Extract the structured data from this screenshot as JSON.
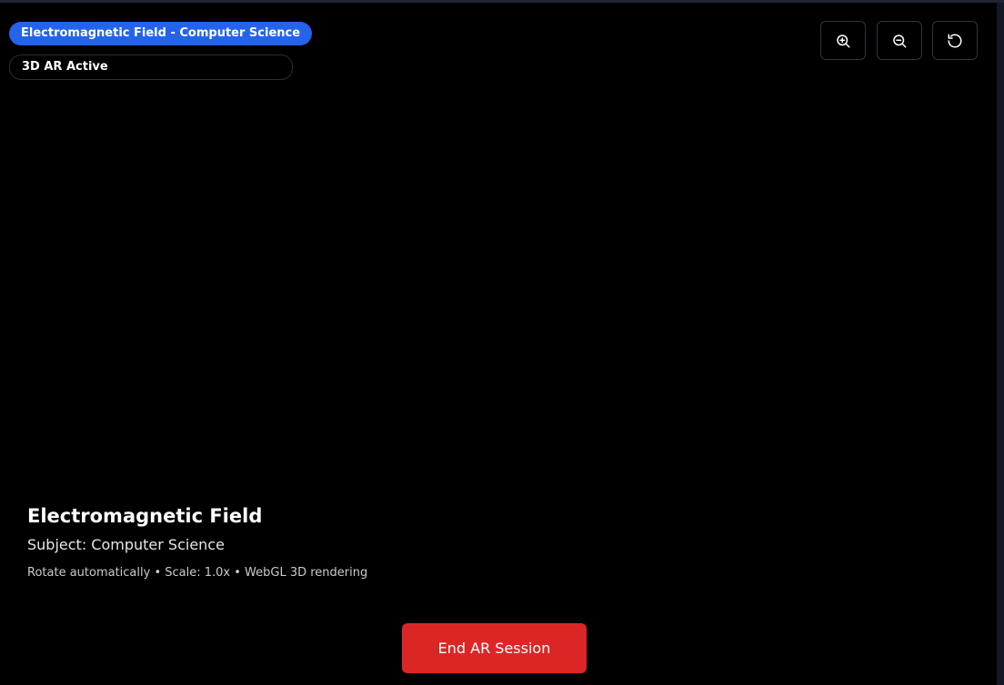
{
  "badges": {
    "primary": "Electromagnetic Field - Computer Science",
    "secondary": "3D AR Active"
  },
  "toolbar": {
    "zoom_in_icon": "zoom-in-icon",
    "zoom_out_icon": "zoom-out-icon",
    "reset_icon": "reset-rotate-icon"
  },
  "info": {
    "title": "Electromagnetic Field",
    "subject": "Subject: Computer Science",
    "meta": "Rotate automatically • Scale: 1.0x • WebGL 3D rendering"
  },
  "actions": {
    "end_label": "End AR Session"
  },
  "colors": {
    "background": "#000000",
    "accent": "#2563eb",
    "danger": "#dc2626"
  }
}
